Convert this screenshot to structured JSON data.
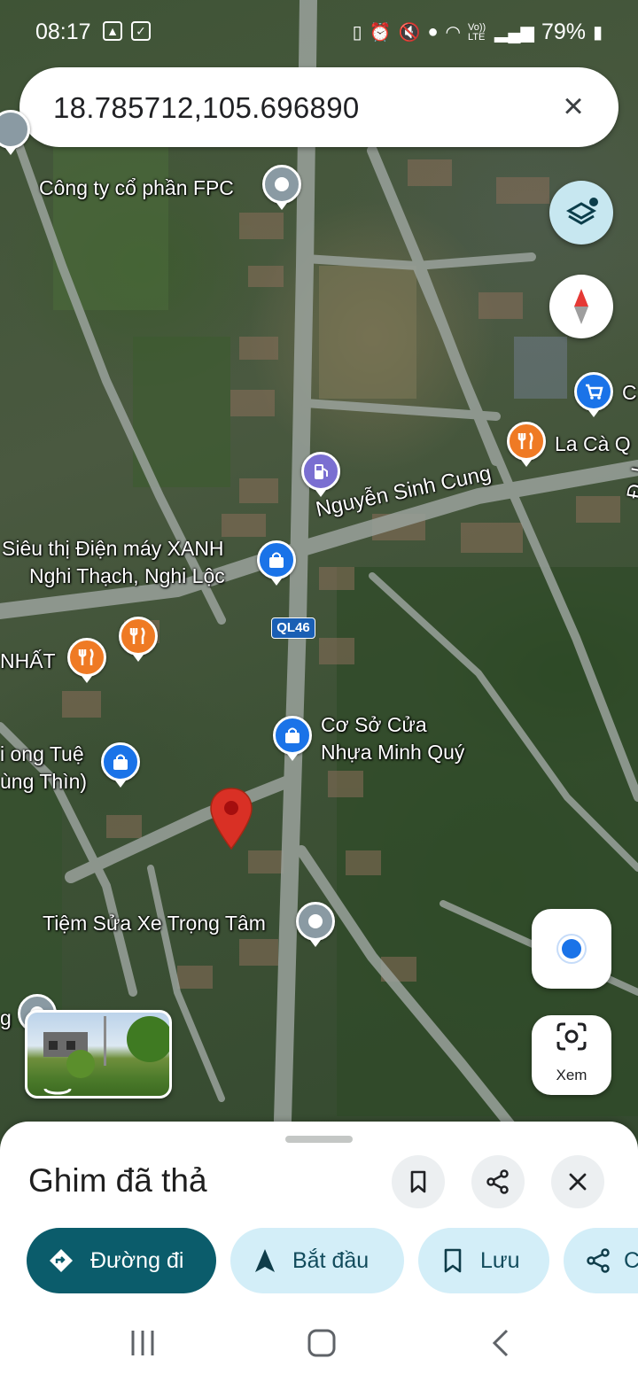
{
  "status_bar": {
    "time": "08:17",
    "battery": "79%",
    "icons": [
      "gallery-icon",
      "check-icon",
      "nfc-icon",
      "alarm-icon",
      "mute-icon",
      "location-icon",
      "wifi-icon",
      "volte-icon",
      "signal-icon",
      "battery-icon"
    ],
    "volte_label": "Vo)) LTE"
  },
  "search": {
    "value": "18.785712,105.696890"
  },
  "map": {
    "labels": {
      "fpc": "Công ty cổ phần FPC",
      "nguyen_sinh_cung": "Nguyễn Sinh Cung",
      "xanh_line1": "Siêu thị Điện máy XANH",
      "xanh_line2": "Nghi Thạch, Nghi Lộc",
      "nhat": "NHẤT",
      "co_so_line1": "Cơ Sở Cửa",
      "co_so_line2": "Nhựa Minh Quý",
      "ong_tue_line1": "i ong Tuệ",
      "ong_tue_line2": "ùng Thìn)",
      "tiem_sua": "Tiệm Sửa Xe Trọng Tâm",
      "la_ca": "La Cà Q",
      "shop_c": "C",
      "g_edge": "g",
      "d_edge": "Đ. L"
    },
    "road_shield": "QL46",
    "lens_label": "Xem"
  },
  "sheet": {
    "title": "Ghim đã thả",
    "actions": {
      "directions": "Đường đi",
      "start": "Bắt đầu",
      "save": "Lưu",
      "share": "C"
    }
  },
  "colors": {
    "accent": "#0b5c6b",
    "chip_bg": "#d3eef8",
    "pin_red": "#d93025",
    "poi_blue": "#1a73e8",
    "poi_orange": "#ef7a24"
  }
}
